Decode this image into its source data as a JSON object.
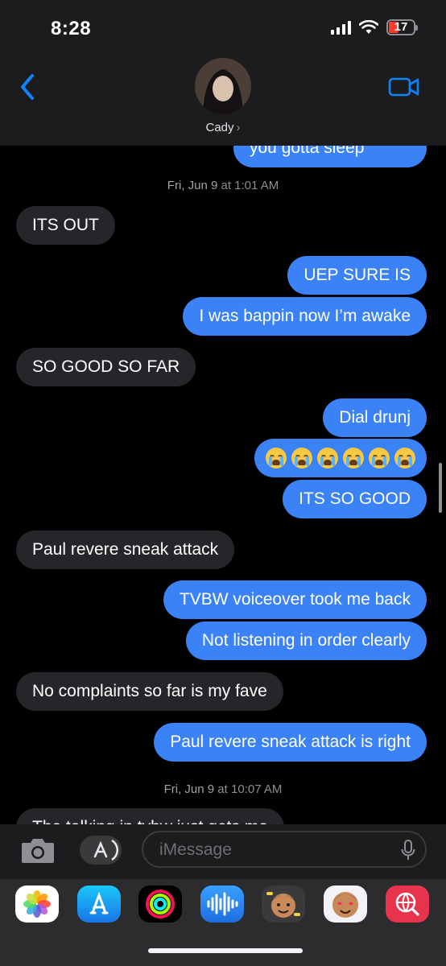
{
  "status": {
    "time": "8:28",
    "battery": "17"
  },
  "header": {
    "contact_name": "Cady",
    "chevron": "›"
  },
  "thread": {
    "partial_top_text": "you gotta sleep",
    "timestamps": [
      {
        "day": "Fri, Jun 9",
        "sep": " at ",
        "time": "1:01 AM"
      },
      {
        "day": "Fri, Jun 9",
        "sep": " at ",
        "time": "10:07 AM"
      }
    ],
    "messages": [
      {
        "text": "ITS OUT"
      },
      {
        "text": "UEP SURE IS"
      },
      {
        "text": "I was bappin now I’m awake"
      },
      {
        "text": "SO GOOD SO FAR"
      },
      {
        "text": "Dial drunj"
      },
      {
        "text": "😭😭😭😭😭😭"
      },
      {
        "text": "ITS SO GOOD"
      },
      {
        "text": "Paul revere sneak attack"
      },
      {
        "text": "TVBW voiceover took me back"
      },
      {
        "text": "Not listening in order clearly"
      },
      {
        "text": "No complaints so far is my fave"
      },
      {
        "text": "Paul revere sneak attack is right"
      },
      {
        "text": "The talking in tvbw just gets me"
      }
    ]
  },
  "input": {
    "placeholder": "iMessage"
  },
  "drawer": {
    "apps": [
      "photos-app",
      "app-store-app",
      "activity-app",
      "audio-message-app",
      "memoji-app",
      "memoji-stickers-app",
      "search-images-app"
    ]
  },
  "colors": {
    "sent": "#3b82f6",
    "received": "#26262a",
    "accent": "#0a84ff"
  }
}
